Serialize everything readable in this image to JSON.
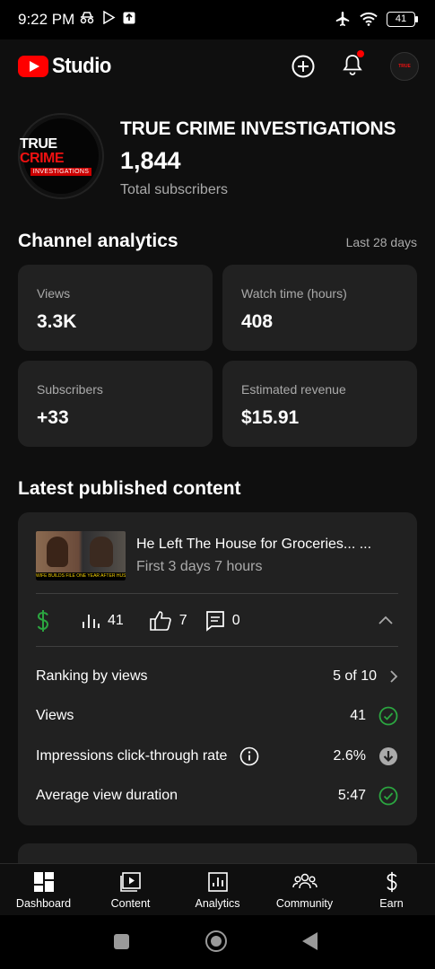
{
  "status_bar": {
    "time": "9:22 PM",
    "battery": "41"
  },
  "topbar": {
    "logo_text": "Studio"
  },
  "channel": {
    "name": "TRUE CRIME INVESTIGATIONS",
    "subscriber_count": "1,844",
    "subscriber_label": "Total subscribers",
    "avatar_line1a": "TRUE",
    "avatar_line1b": "CRIME",
    "avatar_line2": "INVESTIGATIONS"
  },
  "analytics": {
    "heading": "Channel analytics",
    "period": "Last 28 days",
    "cards": [
      {
        "label": "Views",
        "value": "3.3K"
      },
      {
        "label": "Watch time (hours)",
        "value": "408"
      },
      {
        "label": "Subscribers",
        "value": "+33"
      },
      {
        "label": "Estimated revenue",
        "value": "$15.91"
      }
    ]
  },
  "latest": {
    "heading": "Latest published content",
    "video": {
      "title": "He Left The House for Groceries... ...",
      "subtitle": "First 3 days 7 hours",
      "thumbnail_caption": "WIFE BUILDS FILE ONE YEAR AFTER HUSBAND IS A KILLER",
      "views": "41",
      "likes": "7",
      "comments": "0"
    },
    "rows": [
      {
        "label": "Ranking by views",
        "value": "5 of 10"
      },
      {
        "label": "Views",
        "value": "41"
      },
      {
        "label": "Impressions click-through rate",
        "value": "2.6%"
      },
      {
        "label": "Average view duration",
        "value": "5:47"
      }
    ]
  },
  "bottom_nav": [
    {
      "label": "Dashboard"
    },
    {
      "label": "Content"
    },
    {
      "label": "Analytics"
    },
    {
      "label": "Community"
    },
    {
      "label": "Earn"
    }
  ],
  "colors": {
    "accent_red": "#ff0000",
    "success_green": "#2ba640",
    "card_bg": "#212121",
    "page_bg": "#0f0f0f"
  }
}
